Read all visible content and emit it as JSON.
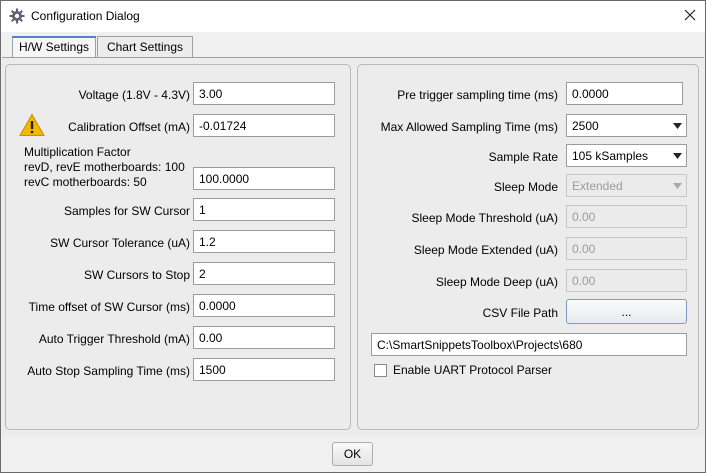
{
  "window": {
    "title": "Configuration Dialog",
    "icon": "gear-icon",
    "close_icon": "close-icon"
  },
  "tabs": [
    {
      "label": "H/W Settings",
      "active": true
    },
    {
      "label": "Chart Settings",
      "active": false
    }
  ],
  "left_panel": {
    "voltage": {
      "label": "Voltage (1.8V - 4.3V)",
      "value": "3.00"
    },
    "calibration": {
      "label": "Calibration Offset (mA)",
      "value": "-0.01724",
      "icon": "warning-icon"
    },
    "multiplication": {
      "label_line1": "Multiplication Factor",
      "label_line2": "revD, revE motherboards: 100",
      "label_line3": "revC motherboards: 50",
      "value": "100.0000"
    },
    "samples_sw_cursor": {
      "label": "Samples for SW Cursor",
      "value": "1"
    },
    "sw_cursor_tolerance": {
      "label": "SW Cursor Tolerance (uA)",
      "value": "1.2"
    },
    "sw_cursors_to_stop": {
      "label": "SW Cursors to Stop",
      "value": "2"
    },
    "time_offset_sw_cursor": {
      "label": "Time offset of SW Cursor (ms)",
      "value": "0.0000"
    },
    "auto_trigger_threshold": {
      "label": "Auto Trigger Threshold (mA)",
      "value": "0.00"
    },
    "auto_stop_sampling_time": {
      "label": "Auto Stop Sampling Time (ms)",
      "value": "1500"
    }
  },
  "right_panel": {
    "pre_trigger": {
      "label": "Pre trigger sampling time (ms)",
      "value": "0.0000"
    },
    "max_sampling_time": {
      "label": "Max Allowed Sampling Time (ms)",
      "value": "2500"
    },
    "sample_rate": {
      "label": "Sample Rate",
      "value": "105 kSamples"
    },
    "sleep_mode": {
      "label": "Sleep Mode",
      "value": "Extended",
      "enabled": false
    },
    "sleep_threshold": {
      "label": "Sleep Mode Threshold (uA)",
      "value": "0.00",
      "enabled": false
    },
    "sleep_extended": {
      "label": "Sleep Mode Extended (uA)",
      "value": "0.00",
      "enabled": false
    },
    "sleep_deep": {
      "label": "Sleep Mode Deep (uA)",
      "value": "0.00",
      "enabled": false
    },
    "csv_path": {
      "label": "CSV File Path",
      "button_label": "...",
      "value": "C:\\SmartSnippetsToolbox\\Projects\\680"
    },
    "uart_parser": {
      "label": "Enable UART Protocol Parser",
      "checked": false
    }
  },
  "footer": {
    "ok_label": "OK"
  },
  "colors": {
    "tab_accent": "#4d85c8",
    "button_border": "#7a9cc6",
    "warning": "#f5b800"
  }
}
